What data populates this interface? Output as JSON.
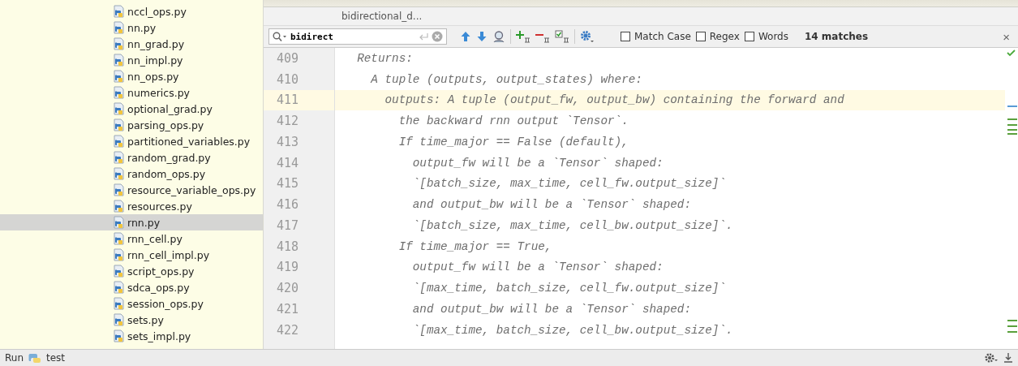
{
  "project_tree": {
    "items": [
      {
        "label": "nccl_ops.py",
        "selected": false
      },
      {
        "label": "nn.py",
        "selected": false
      },
      {
        "label": "nn_grad.py",
        "selected": false
      },
      {
        "label": "nn_impl.py",
        "selected": false
      },
      {
        "label": "nn_ops.py",
        "selected": false
      },
      {
        "label": "numerics.py",
        "selected": false
      },
      {
        "label": "optional_grad.py",
        "selected": false
      },
      {
        "label": "parsing_ops.py",
        "selected": false
      },
      {
        "label": "partitioned_variables.py",
        "selected": false
      },
      {
        "label": "random_grad.py",
        "selected": false
      },
      {
        "label": "random_ops.py",
        "selected": false
      },
      {
        "label": "resource_variable_ops.py",
        "selected": false
      },
      {
        "label": "resources.py",
        "selected": false
      },
      {
        "label": "rnn.py",
        "selected": true
      },
      {
        "label": "rnn_cell.py",
        "selected": false
      },
      {
        "label": "rnn_cell_impl.py",
        "selected": false
      },
      {
        "label": "script_ops.py",
        "selected": false
      },
      {
        "label": "sdca_ops.py",
        "selected": false
      },
      {
        "label": "session_ops.py",
        "selected": false
      },
      {
        "label": "sets.py",
        "selected": false
      },
      {
        "label": "sets_impl.py",
        "selected": false
      }
    ]
  },
  "editor": {
    "breadcrumb": "bidirectional_d...",
    "search": {
      "value": "bidirect",
      "options": [
        {
          "label": "Match Case",
          "checked": false
        },
        {
          "label": "Regex",
          "checked": false
        },
        {
          "label": "Words",
          "checked": false
        }
      ],
      "matches": "14 matches",
      "close": "×"
    },
    "lines": [
      {
        "number": "409",
        "text": "  Returns:",
        "current": false
      },
      {
        "number": "410",
        "text": "    A tuple (outputs, output_states) where:",
        "current": false
      },
      {
        "number": "411",
        "text": "      outputs: A tuple (output_fw, output_bw) containing the forward and",
        "current": true
      },
      {
        "number": "412",
        "text": "        the backward rnn output `Tensor`.",
        "current": false
      },
      {
        "number": "413",
        "text": "        If time_major == False (default),",
        "current": false
      },
      {
        "number": "414",
        "text": "          output_fw will be a `Tensor` shaped:",
        "current": false
      },
      {
        "number": "415",
        "text": "          `[batch_size, max_time, cell_fw.output_size]`",
        "current": false
      },
      {
        "number": "416",
        "text": "          and output_bw will be a `Tensor` shaped:",
        "current": false
      },
      {
        "number": "417",
        "text": "          `[batch_size, max_time, cell_bw.output_size]`.",
        "current": false
      },
      {
        "number": "418",
        "text": "        If time_major == True,",
        "current": false
      },
      {
        "number": "419",
        "text": "          output_fw will be a `Tensor` shaped:",
        "current": false
      },
      {
        "number": "420",
        "text": "          `[max_time, batch_size, cell_fw.output_size]`",
        "current": false
      },
      {
        "number": "421",
        "text": "          and output_bw will be a `Tensor` shaped:",
        "current": false
      },
      {
        "number": "422",
        "text": "          `[max_time, batch_size, cell_bw.output_size]`.",
        "current": false
      }
    ]
  },
  "status_bar": {
    "tool": "Run",
    "configuration": "test"
  }
}
